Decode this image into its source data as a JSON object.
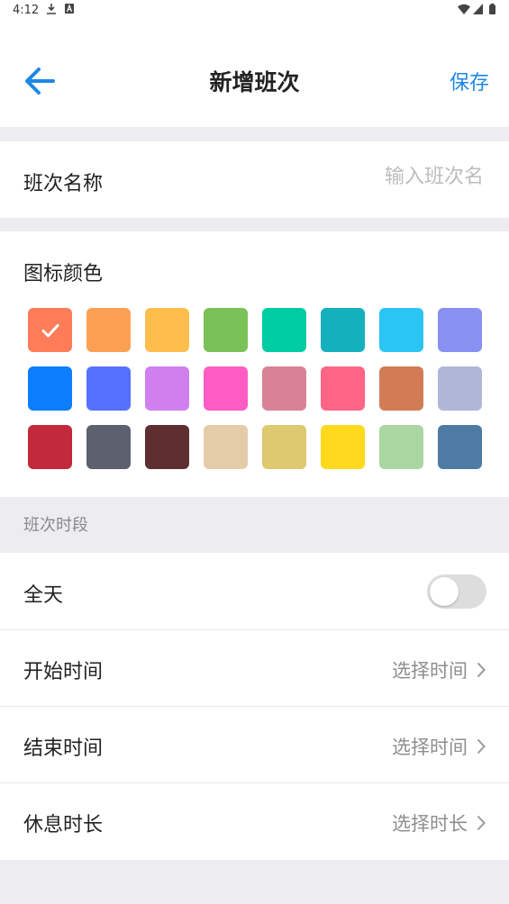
{
  "status_bar": {
    "time": "4:12",
    "left_icons": [
      "download-icon",
      "a-icon"
    ],
    "right_icons": [
      "wifi-icon",
      "signal-icon",
      "battery-icon"
    ]
  },
  "header": {
    "title": "新增班次",
    "save_label": "保存",
    "back_icon": "arrow-left-icon",
    "accent": "#1E88E5"
  },
  "name_row": {
    "label": "班次名称",
    "placeholder": "输入班次名"
  },
  "icon_color": {
    "label": "图标颜色",
    "selected_index": 0,
    "swatches": [
      "#FC7D58",
      "#FCA054",
      "#FFBE4C",
      "#7AC157",
      "#00CCA3",
      "#14B0BD",
      "#2BC5F3",
      "#8890F2",
      "#0D7EFE",
      "#5670FF",
      "#D07FEF",
      "#FF5DC4",
      "#D98296",
      "#FF6586",
      "#D17C55",
      "#B0B6D7",
      "#C2293A",
      "#5D606E",
      "#5E2E30",
      "#E5CCA9",
      "#DEC870",
      "#FFD91B",
      "#A9D6A1",
      "#4D7BA3"
    ]
  },
  "period_section": {
    "header": "班次时段",
    "all_day": {
      "label": "全天",
      "on": false
    },
    "start_time": {
      "label": "开始时间",
      "value": "选择时间"
    },
    "end_time": {
      "label": "结束时间",
      "value": "选择时间"
    },
    "rest_duration": {
      "label": "休息时长",
      "value": "选择时长"
    }
  }
}
